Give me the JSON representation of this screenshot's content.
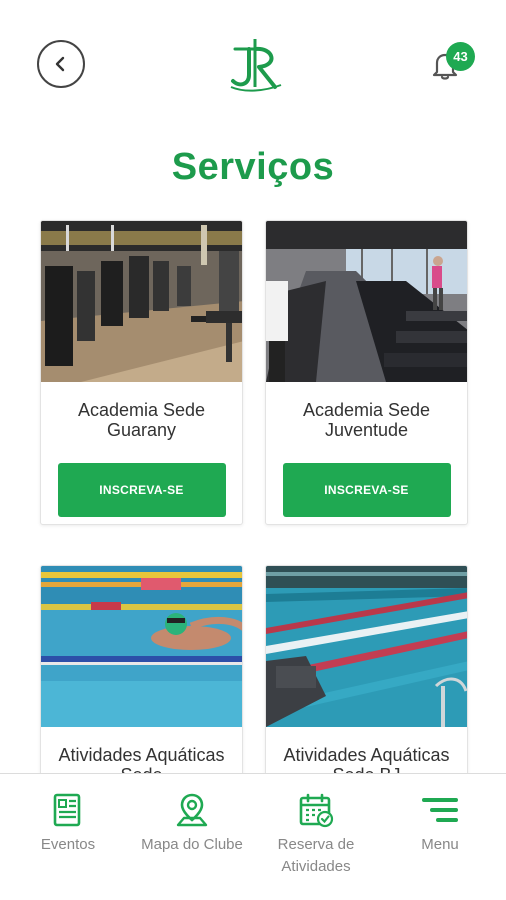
{
  "header": {
    "back_icon": "chevron-left-icon",
    "logo_icon": "club-monogram-logo",
    "notifications_count": "43"
  },
  "page": {
    "title": "Serviços"
  },
  "cards": [
    {
      "name": "Academia Sede Guarany",
      "button": "INSCREVA-SE",
      "image": "gym-weight-machines-photo"
    },
    {
      "name": "Academia Sede Juventude",
      "button": "INSCREVA-SE",
      "image": "gym-treadmills-photo"
    },
    {
      "name": "Atividades Aquáticas Sede",
      "image": "swimmer-in-pool-photo"
    },
    {
      "name": "Atividades Aquáticas Sede BJ",
      "image": "indoor-pool-lanes-photo"
    }
  ],
  "bottom_nav": [
    {
      "label": "Eventos",
      "icon": "newspaper-icon"
    },
    {
      "label": "Mapa do Clube",
      "icon": "map-pin-icon"
    },
    {
      "label": "Reserva de Atividades",
      "icon": "calendar-check-icon"
    },
    {
      "label": "Menu",
      "icon": "hamburger-menu-icon"
    }
  ],
  "colors": {
    "accent": "#1fa952",
    "title": "#1d9b4c",
    "nav_text": "#888888"
  }
}
